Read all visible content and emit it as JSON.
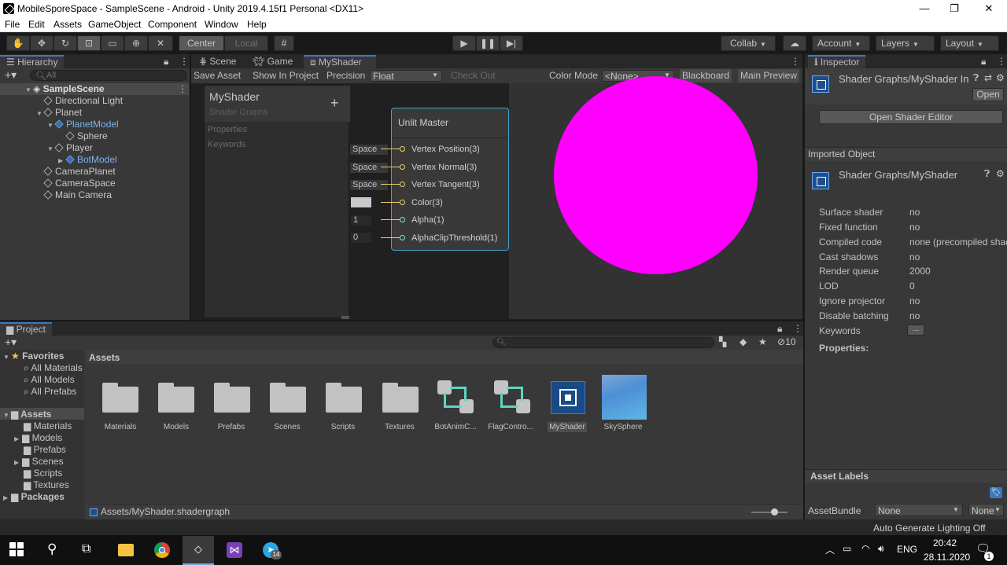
{
  "window": {
    "title": "MobileSporeSpace - SampleScene - Android - Unity 2019.4.15f1 Personal <DX11>",
    "minimize": "—",
    "maximize": "❐",
    "close": "✕"
  },
  "menu": [
    "File",
    "Edit",
    "Assets",
    "GameObject",
    "Component",
    "Window",
    "Help"
  ],
  "toolbar": {
    "pivot": "Center",
    "space": "Local",
    "collab": "Collab",
    "account": "Account",
    "layers": "Layers",
    "layout": "Layout"
  },
  "hierarchy": {
    "tab": "Hierarchy",
    "search_placeholder": "All",
    "scene": "SampleScene",
    "items": [
      "Directional Light",
      "Planet",
      "PlanetModel",
      "Sphere",
      "Player",
      "BotModel",
      "CameraPlanet",
      "CameraSpace",
      "Main Camera"
    ]
  },
  "center_tabs": [
    "Scene",
    "Game",
    "MyShader"
  ],
  "shader_toolbar": {
    "save_asset": "Save Asset",
    "show_in_project": "Show In Project",
    "precision_label": "Precision",
    "precision_value": "Float",
    "check_out": "Check Out",
    "color_mode_label": "Color Mode",
    "color_mode_value": "<None>",
    "blackboard": "Blackboard",
    "main_preview": "Main Preview"
  },
  "blackboard": {
    "title": "MyShader",
    "subtitle": "Shader Graphs",
    "add": "+",
    "section_properties": "Properties",
    "section_keywords": "Keywords"
  },
  "master_node": {
    "title": "Unlit Master",
    "ports": [
      "Vertex Position(3)",
      "Vertex Normal(3)",
      "Vertex Tangent(3)",
      "Color(3)",
      "Alpha(1)",
      "AlphaClipThreshold(1)"
    ],
    "inputs": [
      "Space",
      "Space",
      "Space",
      "",
      "1",
      "0"
    ]
  },
  "preview": {
    "sphere_color": "#ff00ff"
  },
  "inspector": {
    "tab": "Inspector",
    "asset_title": "Shader Graphs/MyShader In",
    "open": "Open",
    "open_editor": "Open Shader Editor",
    "imported_header": "Imported Object",
    "imported_title": "Shader Graphs/MyShader",
    "props": [
      {
        "name": "Surface shader",
        "value": "no"
      },
      {
        "name": "Fixed function",
        "value": "no"
      },
      {
        "name": "Compiled code",
        "value": "none (precompiled shac"
      },
      {
        "name": "Cast shadows",
        "value": "no"
      },
      {
        "name": "Render queue",
        "value": "2000"
      },
      {
        "name": "LOD",
        "value": "0"
      },
      {
        "name": "Ignore projector",
        "value": "no"
      },
      {
        "name": "Disable batching",
        "value": "no"
      },
      {
        "name": "Keywords",
        "value": "..."
      }
    ],
    "properties_label": "Properties:",
    "asset_labels": "Asset Labels",
    "assetbundle_label": "AssetBundle",
    "assetbundle_value": "None",
    "assetbundle_variant": "None"
  },
  "project": {
    "tab": "Project",
    "hidden_count": "10",
    "favorites": "Favorites",
    "fav_items": [
      "All Materials",
      "All Models",
      "All Prefabs"
    ],
    "assets_root": "Assets",
    "asset_folders": [
      "Materials",
      "Models",
      "Prefabs",
      "Scenes",
      "Scripts",
      "Textures"
    ],
    "packages": "Packages",
    "breadcrumb": "Assets",
    "grid": [
      "Materials",
      "Models",
      "Prefabs",
      "Scenes",
      "Scripts",
      "Textures",
      "BotAnimC...",
      "FlagContro...",
      "MyShader",
      "SkySphere"
    ],
    "path": "Assets/MyShader.shadergraph"
  },
  "status": {
    "lighting": "Auto Generate Lighting Off"
  },
  "taskbar": {
    "lang": "ENG",
    "time": "20:42",
    "date": "28.11.2020",
    "telegram_badge": "14",
    "notif_badge": "1"
  }
}
